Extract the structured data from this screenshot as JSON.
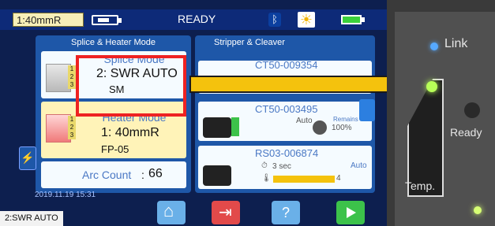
{
  "topbar": {
    "mode_chip": "1:40mmR",
    "status": "READY"
  },
  "left_panel": {
    "title": "Splice & Heater Mode",
    "splice": {
      "label": "Splice Mode",
      "value": "2: SWR AUTO",
      "sub": "SM"
    },
    "heater": {
      "label": "Heater Mode",
      "value": "1: 40mmR",
      "sub": "FP-05"
    },
    "arc": {
      "label": "Arc Count",
      "separator": ":",
      "value": "66"
    }
  },
  "right_panel": {
    "title": "Stripper & Cleaver",
    "cards": [
      {
        "code": "CT50-009354"
      },
      {
        "code": "CT50-003495",
        "auto": "Auto",
        "remains_label": "Remains",
        "remains_value": "100%"
      },
      {
        "code": "RS03-006874",
        "auto": "Auto",
        "time": "3 sec",
        "level": "4"
      }
    ]
  },
  "bottom": {
    "date": "2019.11.19 15:31",
    "mode_label": "2:SWR AUTO"
  },
  "buttons": {
    "home_icon": "home-icon",
    "exit_icon": "exit-icon",
    "help_label": "?",
    "play_icon": "play-icon"
  },
  "hardware": {
    "link_label": "Link",
    "ready_label": "Ready",
    "temp_label": "Temp."
  },
  "colors": {
    "screen_bg": "#0d1f4f",
    "panel_blue": "#1e57a8",
    "highlight_red": "#e22222",
    "arrow_yellow": "#f4c20d",
    "led_green": "#b8ff58"
  }
}
